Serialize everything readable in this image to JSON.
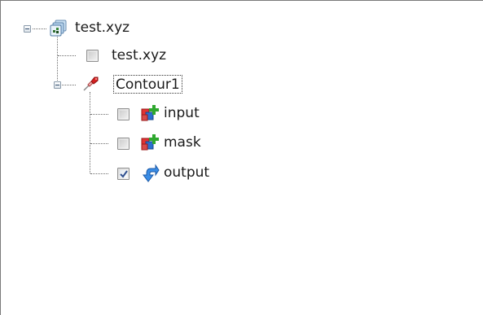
{
  "tree": {
    "root": {
      "label": "test.xyz",
      "icon": "dataset-icon",
      "children": {
        "file": {
          "label": "test.xyz",
          "checked": false
        },
        "filter": {
          "label": "Contour1",
          "icon": "pipette-icon",
          "selected": true,
          "children": [
            {
              "label": "input",
              "icon": "add-input-icon",
              "checked": false
            },
            {
              "label": "mask",
              "icon": "add-input-icon",
              "checked": false
            },
            {
              "label": "output",
              "icon": "output-arrow-icon",
              "checked": true
            }
          ]
        }
      }
    }
  }
}
